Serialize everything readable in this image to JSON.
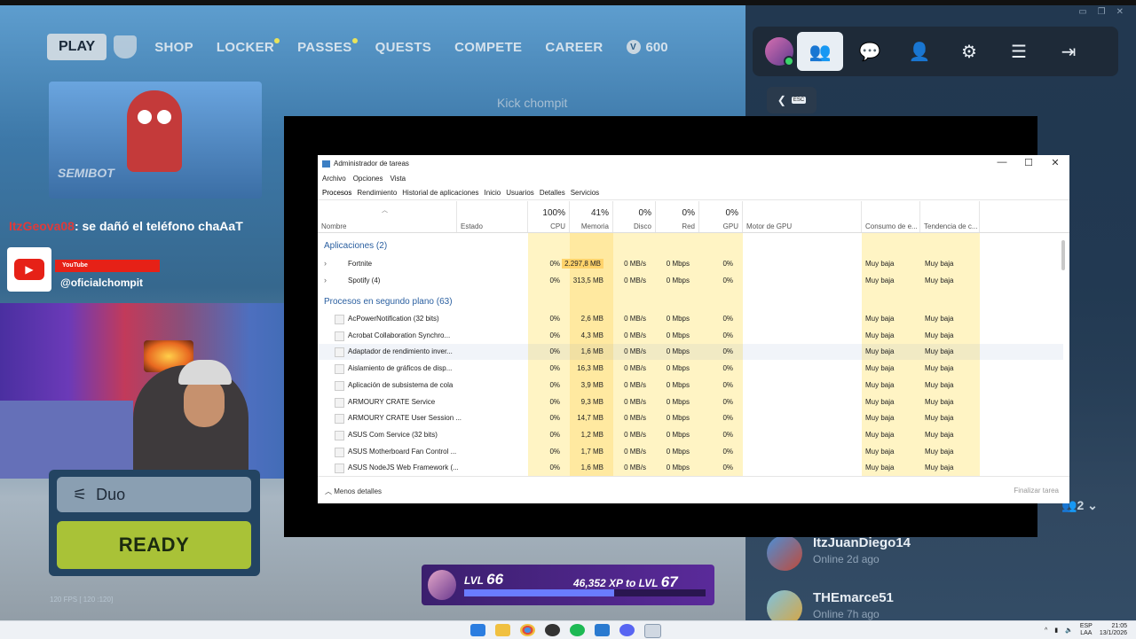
{
  "game": {
    "nav": {
      "play": "PLAY",
      "items": [
        {
          "label": "SHOP",
          "dot": false
        },
        {
          "label": "LOCKER",
          "dot": true
        },
        {
          "label": "PASSES",
          "dot": true
        },
        {
          "label": "QUESTS",
          "dot": false
        },
        {
          "label": "COMPETE",
          "dot": false
        },
        {
          "label": "CAREER",
          "dot": false
        }
      ],
      "vbucks_icon": "V",
      "vbucks": "600"
    },
    "esc_key": "ESC",
    "card_name": "SEMIBOT",
    "kick_overlay": "Kick  chompit",
    "chat": {
      "user": "ItzGeova08",
      "text": ": se dañó el teléfono chaAaT"
    },
    "youtube_label": "YouTube",
    "youtube_icon": "▶",
    "channel": "@oficialchompit",
    "mode": "Duo",
    "ready": "READY",
    "fps": "120 FPS [ 120 :120]",
    "level": {
      "prefix": "LVL",
      "value": "66",
      "xp": "46,352 XP",
      "to": "to LVL",
      "next": "67",
      "progress": 0.62
    },
    "party_count": "2",
    "friends": [
      {
        "name": "ItzJuanDiego14",
        "status": "Online 2d ago"
      },
      {
        "name": "THEmarce51",
        "status": "Online 7h ago"
      }
    ],
    "colors": {
      "ready": "#a9c237",
      "panel": "#1e2a38",
      "level_fill": "#6a7cff"
    }
  },
  "taskmgr": {
    "title": "Administrador de tareas",
    "window_buttons": [
      "—",
      "☐",
      "✕"
    ],
    "menu": [
      "Archivo",
      "Opciones",
      "Vista"
    ],
    "tabs": [
      "Procesos",
      "Rendimiento",
      "Historial de aplicaciones",
      "Inicio",
      "Usuarios",
      "Detalles",
      "Servicios"
    ],
    "columns": {
      "name": "Nombre",
      "status": "Estado",
      "cpu_pct": "100%",
      "cpu": "CPU",
      "mem_pct": "41%",
      "mem": "Memoria",
      "disk_pct": "0%",
      "disk": "Disco",
      "net_pct": "0%",
      "net": "Red",
      "gpu_pct": "0%",
      "gpu": "GPU",
      "gpu_engine": "Motor de GPU",
      "power": "Consumo de e...",
      "power_trend": "Tendencia de c..."
    },
    "group_apps": "Aplicaciones (2)",
    "group_bg": "Procesos en segundo plano (63)",
    "apps": [
      {
        "name": "Fortnite",
        "cpu": "0%",
        "mem": "2.297,8 MB",
        "disk": "0 MB/s",
        "net": "0 Mbps",
        "gpu": "0%",
        "power": "Muy baja",
        "trend": "Muy baja"
      },
      {
        "name": "Spotify (4)",
        "cpu": "0%",
        "mem": "313,5 MB",
        "disk": "0 MB/s",
        "net": "0 Mbps",
        "gpu": "0%",
        "power": "Muy baja",
        "trend": "Muy baja"
      }
    ],
    "background": [
      {
        "name": "AcPowerNotification (32 bits)",
        "cpu": "0%",
        "mem": "2,6 MB",
        "disk": "0 MB/s",
        "net": "0 Mbps",
        "gpu": "0%",
        "power": "Muy baja",
        "trend": "Muy baja"
      },
      {
        "name": "Acrobat Collaboration Synchro...",
        "cpu": "0%",
        "mem": "4,3 MB",
        "disk": "0 MB/s",
        "net": "0 Mbps",
        "gpu": "0%",
        "power": "Muy baja",
        "trend": "Muy baja"
      },
      {
        "name": "Adaptador de rendimiento inver...",
        "cpu": "0%",
        "mem": "1,6 MB",
        "disk": "0 MB/s",
        "net": "0 Mbps",
        "gpu": "0%",
        "power": "Muy baja",
        "trend": "Muy baja"
      },
      {
        "name": "Aislamiento de gráficos de disp...",
        "cpu": "0%",
        "mem": "16,3 MB",
        "disk": "0 MB/s",
        "net": "0 Mbps",
        "gpu": "0%",
        "power": "Muy baja",
        "trend": "Muy baja"
      },
      {
        "name": "Aplicación de subsistema de cola",
        "cpu": "0%",
        "mem": "3,9 MB",
        "disk": "0 MB/s",
        "net": "0 Mbps",
        "gpu": "0%",
        "power": "Muy baja",
        "trend": "Muy baja"
      },
      {
        "name": "ARMOURY CRATE Service",
        "cpu": "0%",
        "mem": "9,3 MB",
        "disk": "0 MB/s",
        "net": "0 Mbps",
        "gpu": "0%",
        "power": "Muy baja",
        "trend": "Muy baja"
      },
      {
        "name": "ARMOURY CRATE User Session ...",
        "cpu": "0%",
        "mem": "14,7 MB",
        "disk": "0 MB/s",
        "net": "0 Mbps",
        "gpu": "0%",
        "power": "Muy baja",
        "trend": "Muy baja"
      },
      {
        "name": "ASUS Com Service (32 bits)",
        "cpu": "0%",
        "mem": "1,2 MB",
        "disk": "0 MB/s",
        "net": "0 Mbps",
        "gpu": "0%",
        "power": "Muy baja",
        "trend": "Muy baja"
      },
      {
        "name": "ASUS Motherboard Fan Control ...",
        "cpu": "0%",
        "mem": "1,7 MB",
        "disk": "0 MB/s",
        "net": "0 Mbps",
        "gpu": "0%",
        "power": "Muy baja",
        "trend": "Muy baja"
      },
      {
        "name": "ASUS NodeJS Web Framework (...",
        "cpu": "0%",
        "mem": "1,6 MB",
        "disk": "0 MB/s",
        "net": "0 Mbps",
        "gpu": "0%",
        "power": "Muy baja",
        "trend": "Muy baja"
      }
    ],
    "footer_less": "Menos detalles",
    "footer_end": "Finalizar tarea",
    "colors": {
      "heat_light": "#fff4c4",
      "heat_mid": "#ffe9a0",
      "heat_high": "#ffd36b"
    }
  },
  "taskbar": {
    "icons": [
      "windows-start-icon",
      "file-explorer-icon",
      "chrome-icon",
      "obs-icon",
      "spotify-icon",
      "app-f-icon",
      "discord-icon",
      "task-manager-icon"
    ],
    "lang": "ESP",
    "lang2": "LAA",
    "time": "21:05",
    "date": "13/1/2026"
  }
}
